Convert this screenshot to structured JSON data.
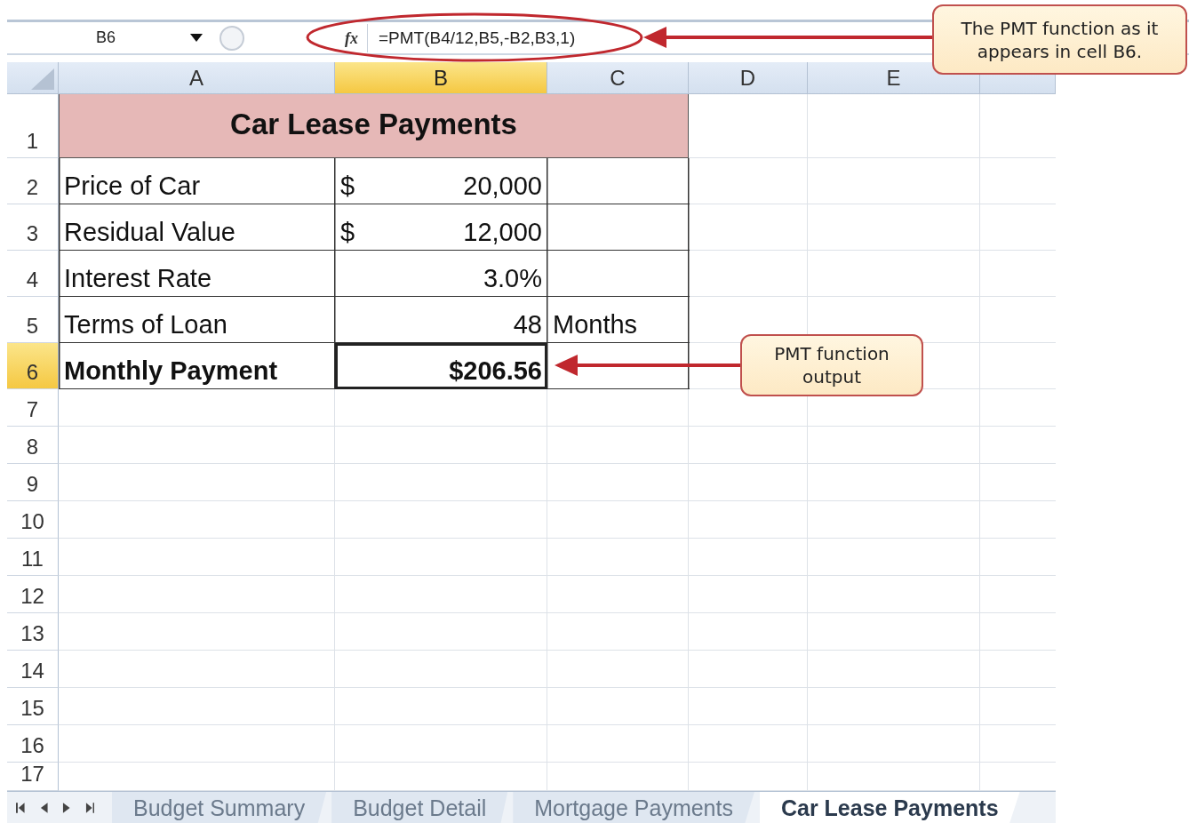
{
  "formula_bar": {
    "name_box": "B6",
    "function_label": "fx",
    "formula": "=PMT(B4/12,B5,-B2,B3,1)"
  },
  "columns": [
    {
      "label": "A",
      "selected": false
    },
    {
      "label": "B",
      "selected": true
    },
    {
      "label": "C",
      "selected": false
    },
    {
      "label": "D",
      "selected": false
    },
    {
      "label": "E",
      "selected": false
    }
  ],
  "rows": [
    {
      "label": "1",
      "kind": "title",
      "selected": false,
      "cells": [
        {
          "kind": "title",
          "text": "Car Lease Payments"
        }
      ]
    },
    {
      "label": "2",
      "kind": "data",
      "selected": false,
      "cells": [
        {
          "kind": "label",
          "text": "Price of Car"
        },
        {
          "kind": "currency",
          "symbol": "$",
          "text": "20,000"
        },
        {
          "kind": "empty"
        }
      ]
    },
    {
      "label": "3",
      "kind": "data",
      "selected": false,
      "cells": [
        {
          "kind": "label",
          "text": "Residual Value"
        },
        {
          "kind": "currency",
          "symbol": "$",
          "text": "12,000"
        },
        {
          "kind": "empty"
        }
      ]
    },
    {
      "label": "4",
      "kind": "data",
      "selected": false,
      "cells": [
        {
          "kind": "label",
          "text": "Interest Rate"
        },
        {
          "kind": "number",
          "text": "3.0%"
        },
        {
          "kind": "empty"
        }
      ]
    },
    {
      "label": "5",
      "kind": "data",
      "selected": false,
      "cells": [
        {
          "kind": "label",
          "text": "Terms of Loan"
        },
        {
          "kind": "number",
          "text": "48"
        },
        {
          "kind": "label",
          "text": "Months"
        }
      ]
    },
    {
      "label": "6",
      "kind": "data",
      "selected": true,
      "cells": [
        {
          "kind": "label",
          "text": "Monthly Payment",
          "bold": true
        },
        {
          "kind": "number",
          "text": "$206.56",
          "bold": true,
          "active": true
        },
        {
          "kind": "empty"
        }
      ]
    },
    {
      "label": "7",
      "kind": "blank",
      "selected": false
    },
    {
      "label": "8",
      "kind": "blank",
      "selected": false
    },
    {
      "label": "9",
      "kind": "blank",
      "selected": false
    },
    {
      "label": "10",
      "kind": "blank",
      "selected": false
    },
    {
      "label": "11",
      "kind": "blank",
      "selected": false
    },
    {
      "label": "12",
      "kind": "blank",
      "selected": false
    },
    {
      "label": "13",
      "kind": "blank",
      "selected": false
    },
    {
      "label": "14",
      "kind": "blank",
      "selected": false
    },
    {
      "label": "15",
      "kind": "blank",
      "selected": false
    },
    {
      "label": "16",
      "kind": "blank",
      "selected": false
    },
    {
      "label": "17",
      "kind": "partial",
      "selected": false
    }
  ],
  "sheet_tabs": [
    {
      "label": "Budget Summary",
      "selected": false
    },
    {
      "label": "Budget Detail",
      "selected": false
    },
    {
      "label": "Mortgage Payments",
      "selected": false
    },
    {
      "label": "Car Lease Payments",
      "selected": true
    }
  ],
  "callouts": [
    {
      "text": "The PMT function as it appears in cell B6."
    },
    {
      "text": "PMT function output"
    }
  ]
}
